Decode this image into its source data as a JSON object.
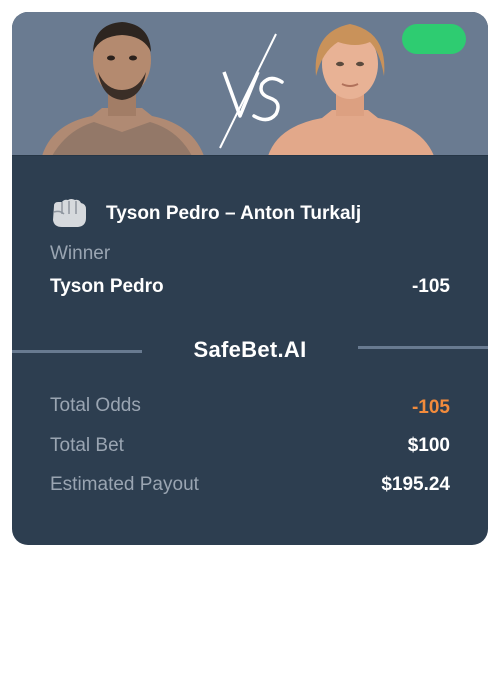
{
  "hero": {
    "left_fighter_icon": "fighter-portrait-icon",
    "right_fighter_icon": "fighter-portrait-icon",
    "vs_icon": "vs-icon",
    "toggle_color": "#2ecc71"
  },
  "bet": {
    "sport_icon": "fist-icon",
    "matchup": "Tyson Pedro – Anton Turkalj",
    "market": "Winner",
    "pick": "Tyson Pedro",
    "pick_odds": "-105"
  },
  "brand": {
    "name": "SafeBet.AI"
  },
  "summary": {
    "total_odds_label": "Total Odds",
    "total_odds_value": "-105",
    "total_bet_label": "Total Bet",
    "total_bet_value": "$100",
    "payout_label": "Estimated Payout",
    "payout_value": "$195.24"
  },
  "colors": {
    "card_bg": "#2d3e50",
    "hero_bg": "#6a7b91",
    "accent_orange": "#f28b3c",
    "muted_text": "#9aa5b2",
    "toggle_green": "#2ecc71"
  }
}
